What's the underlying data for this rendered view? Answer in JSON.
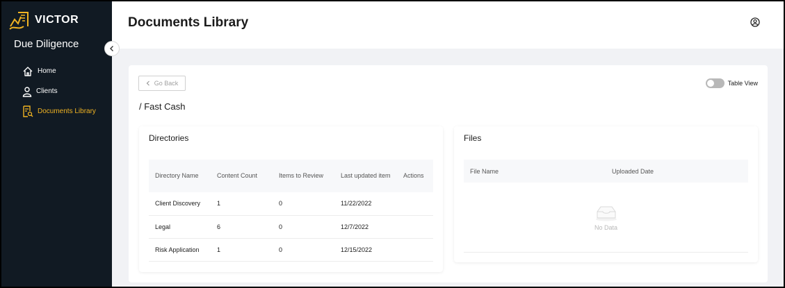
{
  "brand": {
    "name": "VICTOR",
    "accent": "#f0b323"
  },
  "sidebar": {
    "app_title": "Due Diligence",
    "items": [
      {
        "label": "Home",
        "icon": "home-icon",
        "active": false
      },
      {
        "label": "Clients",
        "icon": "user-icon",
        "active": false
      },
      {
        "label": "Documents Library",
        "icon": "document-search-icon",
        "active": true
      }
    ]
  },
  "header": {
    "title": "Documents Library"
  },
  "toolbar": {
    "go_back": "Go Back",
    "table_view": "Table View"
  },
  "breadcrumb": "/ Fast Cash",
  "directories": {
    "title": "Directories",
    "columns": [
      "Directory Name",
      "Content Count",
      "Items to Review",
      "Last updated item",
      "Actions"
    ],
    "rows": [
      {
        "name": "Client Discovery",
        "count": "1",
        "review": "0",
        "updated": "11/22/2022"
      },
      {
        "name": "Legal",
        "count": "6",
        "review": "0",
        "updated": "12/7/2022"
      },
      {
        "name": "Risk Application",
        "count": "1",
        "review": "0",
        "updated": "12/15/2022"
      }
    ]
  },
  "files": {
    "title": "Files",
    "columns": [
      "File Name",
      "Uploaded Date"
    ],
    "empty_text": "No Data"
  }
}
